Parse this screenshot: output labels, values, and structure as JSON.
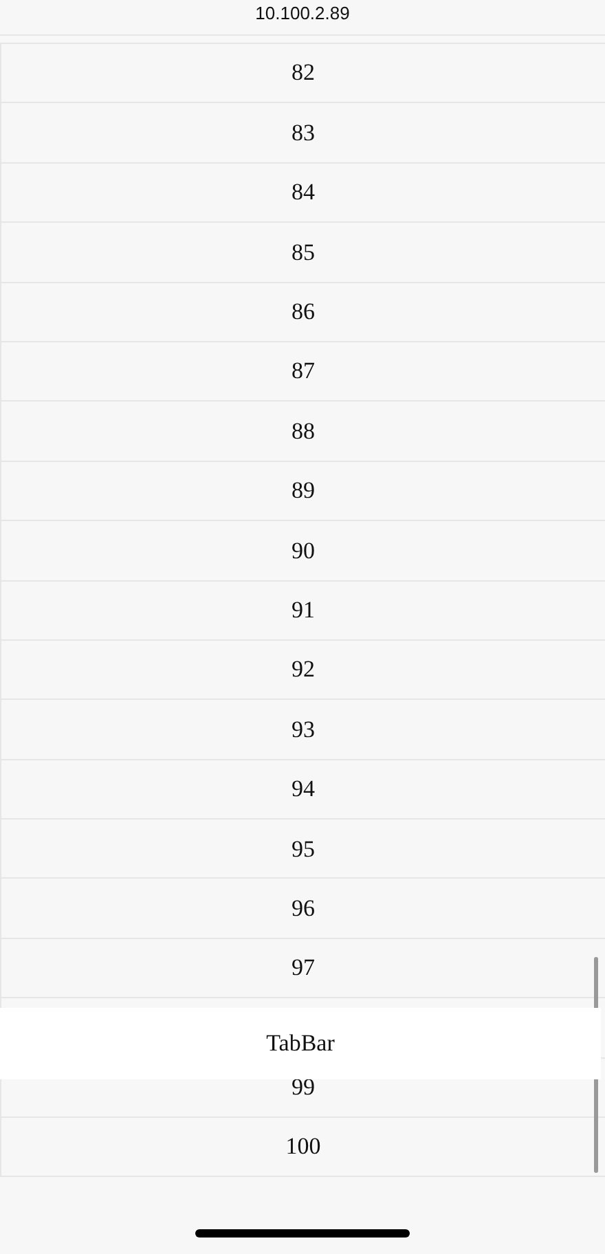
{
  "header": {
    "subtitle": "10.100.2.89"
  },
  "rows": [
    "82",
    "83",
    "84",
    "85",
    "86",
    "87",
    "88",
    "89",
    "90",
    "91",
    "92",
    "93",
    "94",
    "95",
    "96",
    "97",
    "99",
    "100"
  ],
  "tab_bar": {
    "label": "TabBar"
  }
}
